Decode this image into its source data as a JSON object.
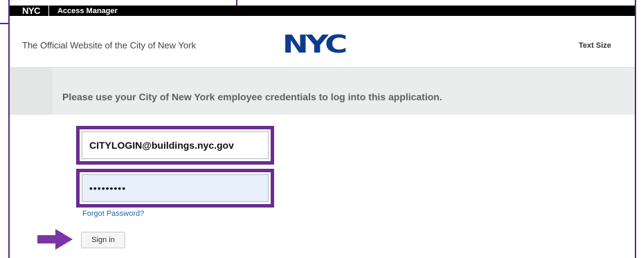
{
  "topbar": {
    "logo": "NYC",
    "title": "Access Manager"
  },
  "header": {
    "site_name": "The Official Website of the City of New York",
    "logo": "NYC",
    "text_size": "Text Size"
  },
  "banner": {
    "message": "Please use your City of New York employee credentials to log into this application."
  },
  "form": {
    "username_value": "CITYLOGIN@buildings.nyc.gov",
    "password_value": "•••••••••",
    "forgot_password": "Forgot Password?",
    "sign_in": "Sign in"
  },
  "colors": {
    "highlight": "#6a2c91",
    "logo": "#0f3b8c",
    "link": "#1a6aa8"
  },
  "icons": {
    "annotation_arrow": "arrow-right-icon"
  }
}
